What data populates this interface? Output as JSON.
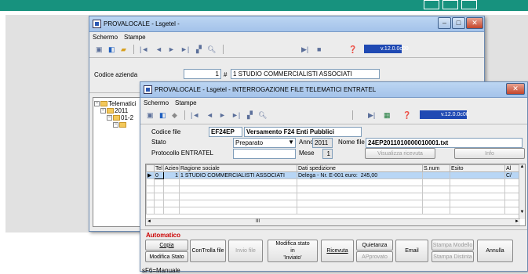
{
  "back": {
    "title": "PROVALOCALE - Lsgetel -",
    "menu": [
      "Schermo",
      "Stampe"
    ],
    "version": "v.12.0.0c00",
    "codice_label": "Codice azienda",
    "codice_value": "1",
    "hash": "#",
    "azienda_name": "1 STUDIO COMMERCIALISTI ASSOCIATI",
    "tree": {
      "root": "Telematici",
      "year": "2011",
      "sub": "01-2"
    }
  },
  "front": {
    "title": "PROVALOCALE - Lsgetel - INTERROGAZIONE FILE TELEMATICI ENTRATEL",
    "menu": [
      "Schermo",
      "Stampe"
    ],
    "version": "v.12.0.0c00",
    "codice_file_label": "Codice file",
    "codice_file_value": "EF24EP",
    "codice_file_desc": "Versamento F24 Enti Pubblici",
    "stato_label": "Stato",
    "stato_value": "Preparato",
    "anno_label": "Anno",
    "anno_value": "2011",
    "nome_file_label": "Nome file",
    "nome_file_value": "24EP2011010000010001.txt",
    "protocollo_label": "Protocollo ENTRATEL",
    "mese_label": "Mese",
    "mese_value": "1",
    "visualizza_label": "Visualizza ricevuta",
    "info_label": "Info",
    "grid": {
      "columns": [
        "Tel",
        "Azienda",
        "Ragione sociale",
        "Dati spedizione",
        "S.num",
        "Esito",
        "Al"
      ],
      "rows": [
        [
          "0",
          "1",
          "1 STUDIO COMMERCIALISTI ASSOCIATI",
          "Delega - Nr. E-001 euro:",
          "245,00",
          "",
          "",
          "C/"
        ]
      ]
    },
    "automatico_label": "Automatico",
    "buttons": {
      "copia": "Copia",
      "modifica_stato": "Modifica Stato",
      "controlla_file": "ConTrolla file",
      "invio_file": "Invio file",
      "modifica_stato_in_1": "Modifica stato",
      "modifica_stato_in_2": "in",
      "modifica_stato_in_3": "'Inviato'",
      "ricevuta": "Ricevuta",
      "quietanza": "Quietanza",
      "approvato": "APprovato",
      "email": "Email",
      "stampa_modello": "Stampa Modello",
      "stampa_distinta": "Stampa Distinta",
      "annulla": "Annulla"
    },
    "status": "sF6=Manuale",
    "scroll_mid": "III"
  },
  "colors": {
    "band": "#17927e",
    "selection": "#b8d6f5",
    "version_box": "#1f49b3",
    "automatico": "#cc0000"
  }
}
